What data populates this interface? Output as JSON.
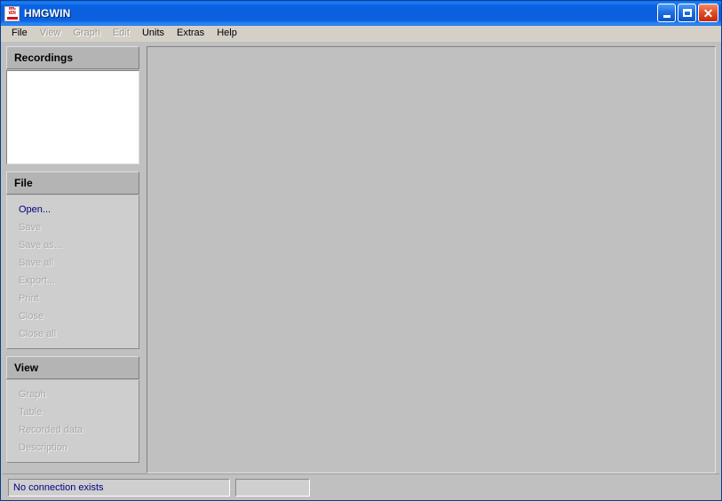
{
  "window": {
    "title": "HMGWIN",
    "icon": "hmgwin-app-icon",
    "icon_line1": "HMG",
    "icon_line2": "WIN",
    "controls": {
      "minimize": "minimize-icon",
      "maximize": "maximize-icon",
      "close": "close-icon",
      "close_glyph": "✕"
    }
  },
  "menubar": {
    "items": [
      {
        "label": "File",
        "enabled": true
      },
      {
        "label": "View",
        "enabled": false
      },
      {
        "label": "Graph",
        "enabled": false
      },
      {
        "label": "Edit",
        "enabled": false
      },
      {
        "label": "Units",
        "enabled": true
      },
      {
        "label": "Extras",
        "enabled": true
      },
      {
        "label": "Help",
        "enabled": true
      }
    ]
  },
  "sidebar": {
    "recordings": {
      "title": "Recordings",
      "items": []
    },
    "file_section": {
      "title": "File",
      "items": [
        {
          "label": "Open...",
          "enabled": true
        },
        {
          "label": "Save",
          "enabled": false
        },
        {
          "label": "Save as...",
          "enabled": false
        },
        {
          "label": "Save all",
          "enabled": false
        },
        {
          "label": "Export...",
          "enabled": false
        },
        {
          "label": "Print",
          "enabled": false
        },
        {
          "label": "Close",
          "enabled": false
        },
        {
          "label": "Close all",
          "enabled": false
        }
      ]
    },
    "view_section": {
      "title": "View",
      "items": [
        {
          "label": "Graph",
          "enabled": false
        },
        {
          "label": "Table",
          "enabled": false
        },
        {
          "label": "Recorded data",
          "enabled": false
        },
        {
          "label": "Description",
          "enabled": false
        }
      ]
    }
  },
  "workspace": {
    "content": ""
  },
  "statusbar": {
    "connection": "No connection exists",
    "secondary": ""
  },
  "colors": {
    "title_bar_blue": "#0a5fdd",
    "link_navy": "#000080",
    "panel_header_grey": "#b4b4b4",
    "panel_body_grey": "#cecece",
    "face_grey": "#c0c0c0",
    "disabled_grey": "#a8a8a8",
    "close_button_red": "#e2502a"
  }
}
